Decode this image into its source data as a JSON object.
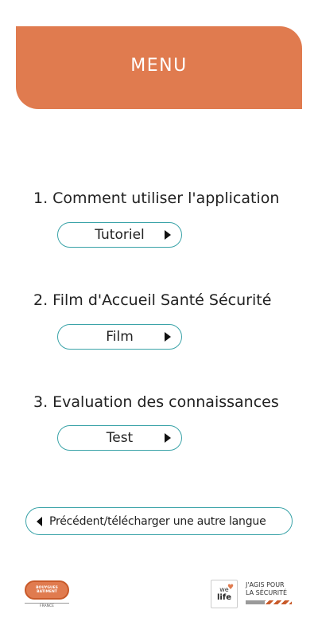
{
  "header": {
    "title": "MENU"
  },
  "sections": [
    {
      "title": "1. Comment utiliser l'application",
      "button": "Tutoriel"
    },
    {
      "title": "2. Film d'Accueil Santé Sécurité",
      "button": "Film"
    },
    {
      "title": "3. Evaluation des connaissances",
      "button": "Test"
    }
  ],
  "footer": {
    "back_label": "Précédent/télécharger une autre langue",
    "logo_left_line1": "BOUYGUES",
    "logo_left_line2": "BATIMENT",
    "logo_left_country": "FRANCE",
    "logo_right_we": "we",
    "logo_right_life": "life",
    "logo_right_line1": "J'AGIS POUR",
    "logo_right_line2": "LA SÉCURITÉ"
  },
  "colors": {
    "accent": "#e07b4f",
    "outline": "#3aa3a8"
  },
  "icons": [
    "play-arrow-icon",
    "back-arrow-icon",
    "heart-icon"
  ]
}
